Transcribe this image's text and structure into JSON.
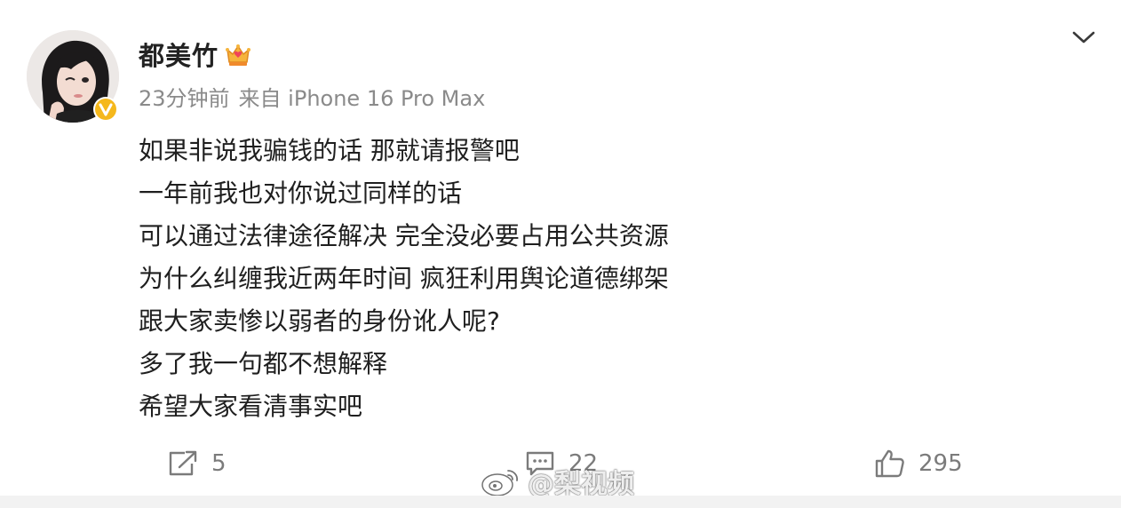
{
  "user": {
    "name": "都美竹",
    "badge_icon": "crown-badge-icon",
    "verified_icon": "verified-v-icon",
    "verified_color": "#f5b81c"
  },
  "meta": {
    "time": "23分钟前",
    "source": "来自 iPhone 16 Pro Max"
  },
  "content": {
    "lines": [
      "如果非说我骗钱的话 那就请报警吧",
      "一年前我也对你说过同样的话",
      "可以通过法律途径解决 完全没必要占用公共资源",
      "为什么纠缠我近两年时间 疯狂利用舆论道德绑架",
      "跟大家卖惨以弱者的身份讹人呢?",
      "多了我一句都不想解释",
      "希望大家看清事实吧"
    ]
  },
  "actions": {
    "share_count": "5",
    "comment_count": "22",
    "like_count": "295"
  },
  "watermark": {
    "text": "@梨视频"
  }
}
